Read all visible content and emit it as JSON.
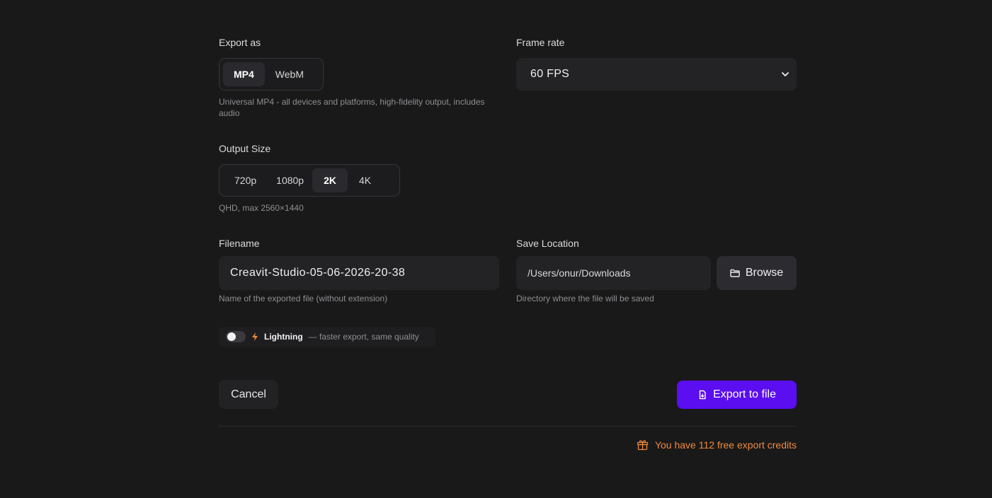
{
  "export_as": {
    "label": "Export as",
    "options": [
      "MP4",
      "WebM"
    ],
    "selected": "MP4",
    "description": "Universal MP4 - all devices and platforms, high-fidelity output, includes audio"
  },
  "frame_rate": {
    "label": "Frame rate",
    "value": "60 FPS"
  },
  "output_size": {
    "label": "Output Size",
    "options": [
      "720p",
      "1080p",
      "2K",
      "4K"
    ],
    "selected": "2K",
    "description": "QHD, max 2560×1440"
  },
  "filename": {
    "label": "Filename",
    "value": "Creavit-Studio-05-06-2026-20-38",
    "description": "Name of the exported file (without extension)"
  },
  "save_location": {
    "label": "Save Location",
    "value": "/Users/onur/Downloads",
    "browse_label": "Browse",
    "description": "Directory where the file will be saved"
  },
  "lightning": {
    "label": "Lightning",
    "description": "— faster export, same quality",
    "enabled": false
  },
  "actions": {
    "cancel_label": "Cancel",
    "export_label": "Export to file"
  },
  "credits": {
    "text": "You have 112 free export credits"
  },
  "colors": {
    "accent": "#5b0ef0",
    "credits": "#f08a3c",
    "lightning": "#f08a3c",
    "background": "#191919"
  },
  "icons": {
    "frame_rate_chevron": "chevron-down-icon",
    "browse": "folder-icon",
    "lightning": "lightning-icon",
    "export": "file-export-icon",
    "credits": "gift-icon"
  }
}
